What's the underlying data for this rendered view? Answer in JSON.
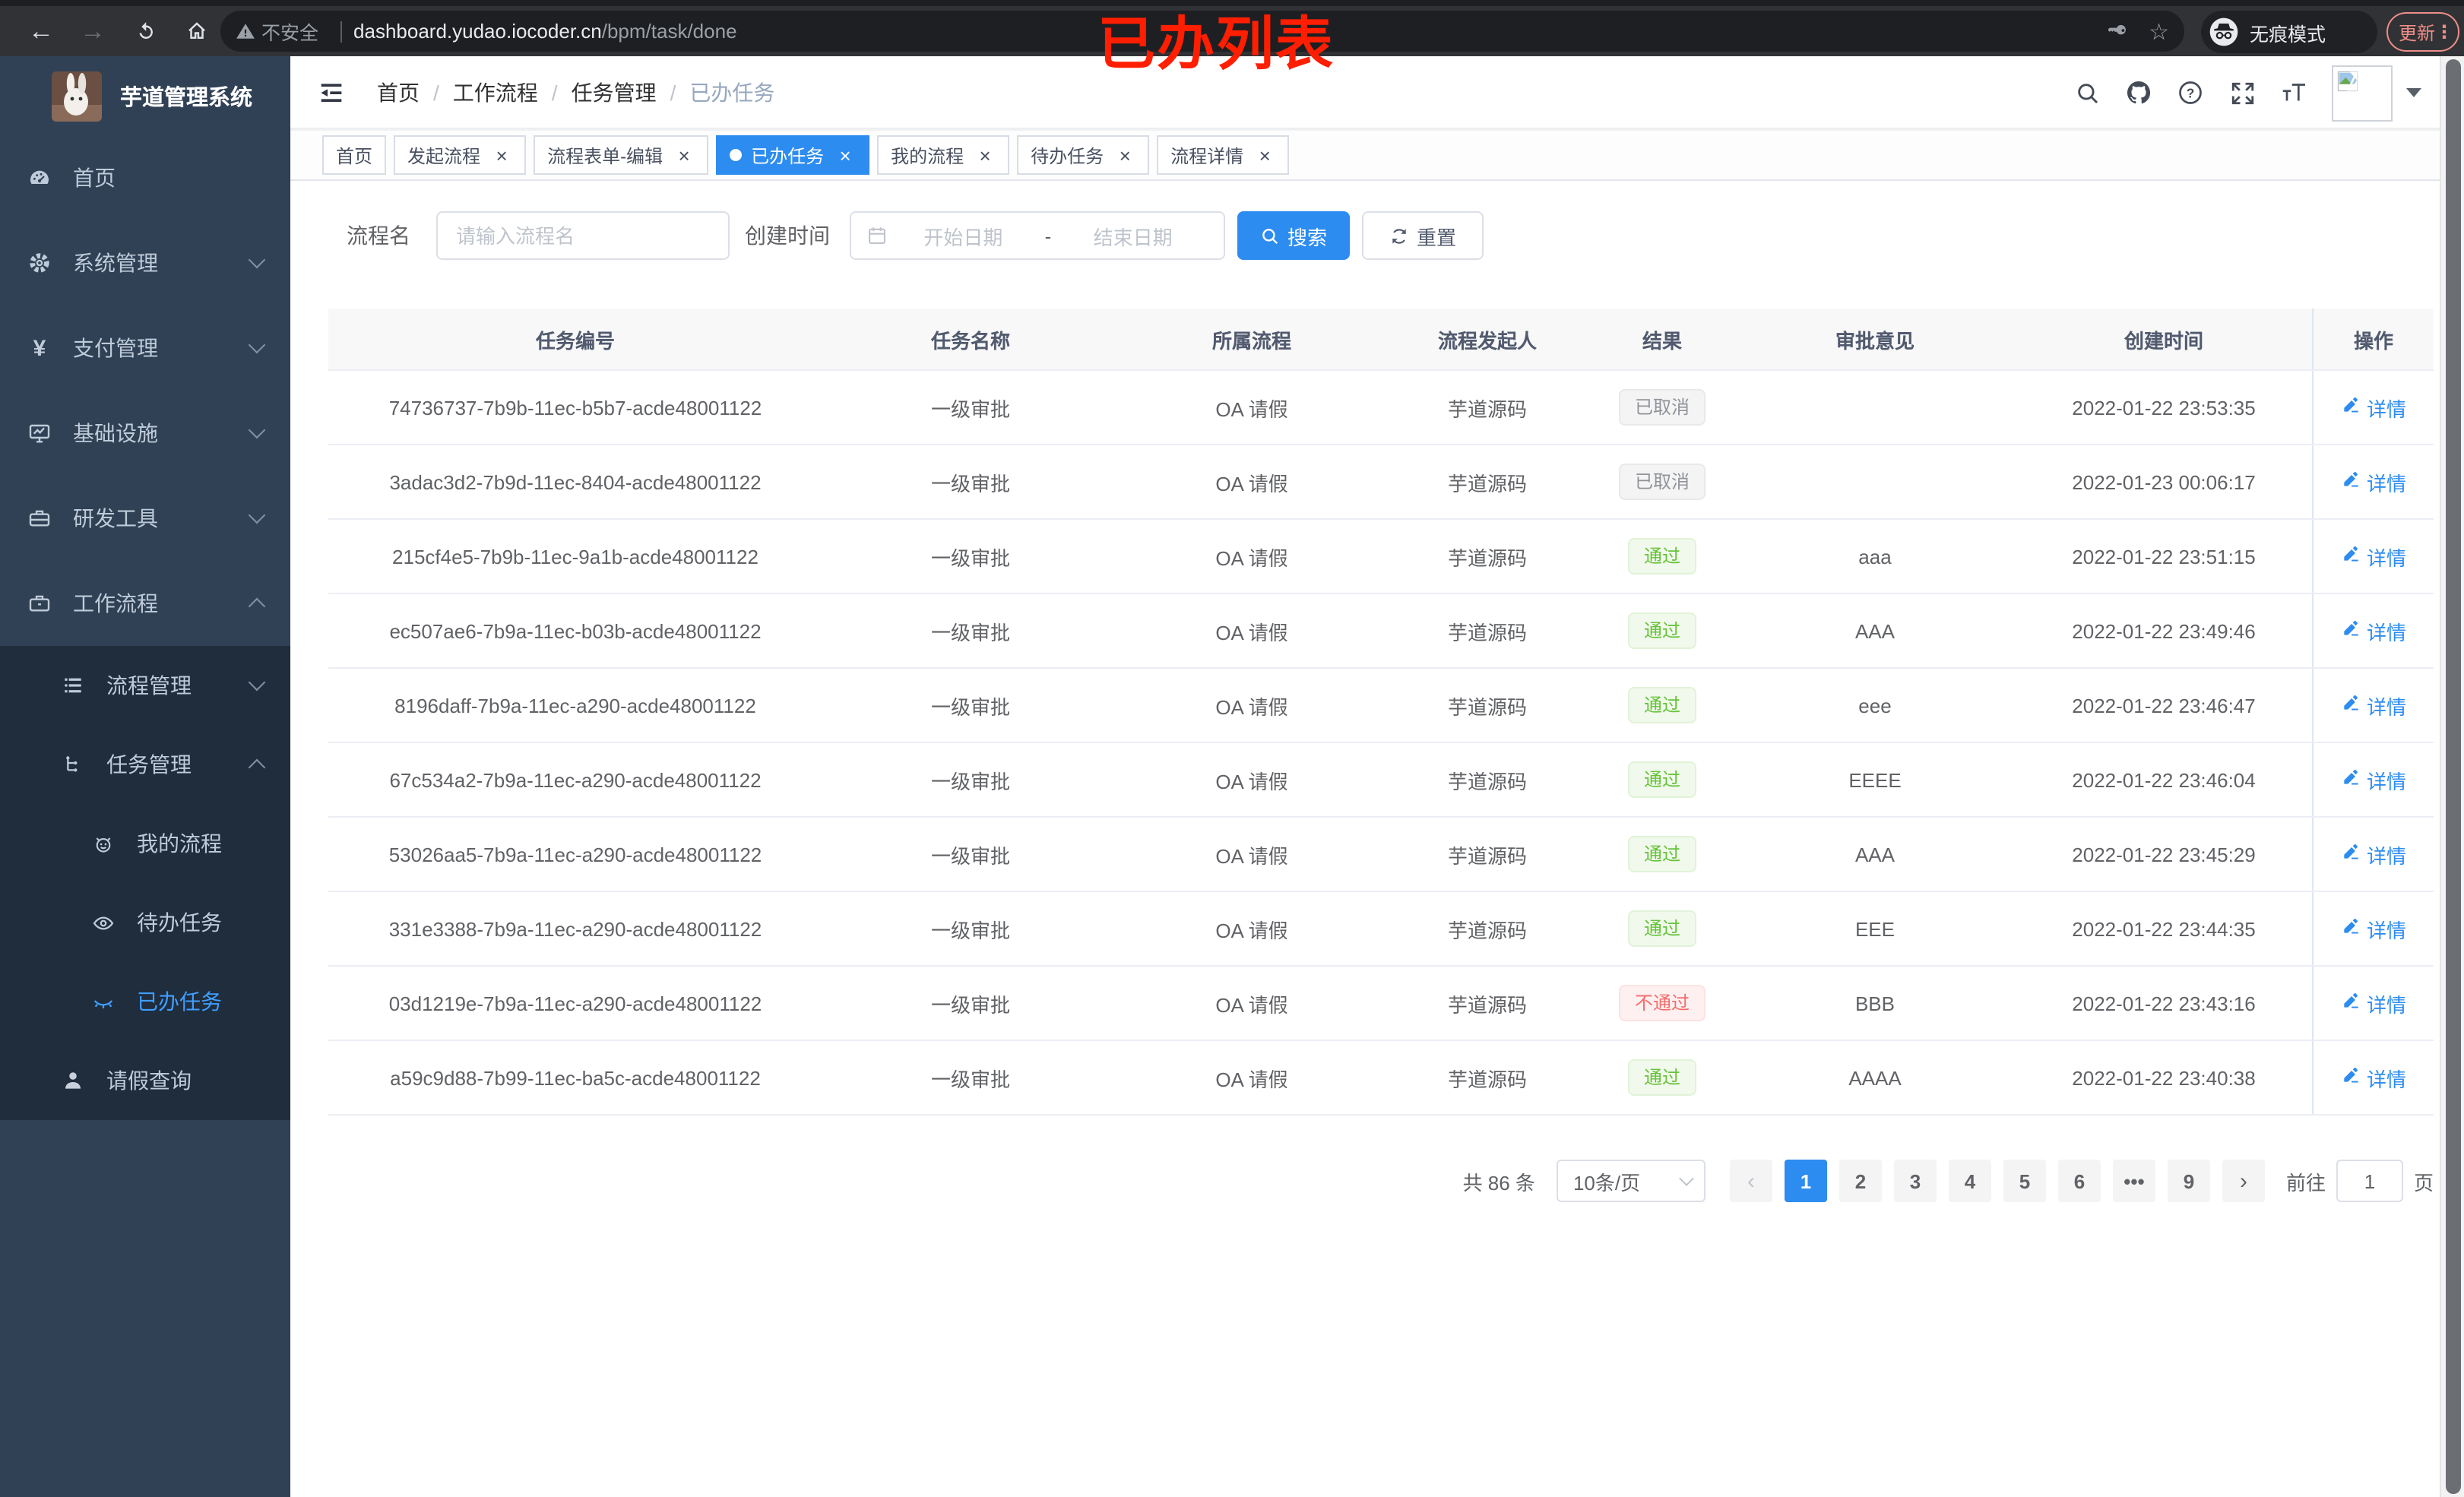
{
  "browser": {
    "annotation": "已办列表",
    "security_label": "不安全",
    "url_host": "dashboard.yudao.iocoder.cn",
    "url_path": "/bpm/task/done",
    "incognito_label": "无痕模式",
    "update_label": "更新"
  },
  "sidebar": {
    "app_title": "芋道管理系统",
    "items": [
      {
        "label": "首页",
        "icon": "dashboard-icon",
        "level": 1
      },
      {
        "label": "系统管理",
        "icon": "gear-icon",
        "level": 1,
        "chevron": "down"
      },
      {
        "label": "支付管理",
        "icon": "yen-icon",
        "level": 1,
        "chevron": "down"
      },
      {
        "label": "基础设施",
        "icon": "monitor-icon",
        "level": 1,
        "chevron": "down"
      },
      {
        "label": "研发工具",
        "icon": "toolbox-icon",
        "level": 1,
        "chevron": "down"
      },
      {
        "label": "工作流程",
        "icon": "briefcase-icon",
        "level": 1,
        "chevron": "up"
      }
    ],
    "submenu": [
      {
        "label": "流程管理",
        "icon": "list-icon",
        "level": 2,
        "chevron": "down"
      },
      {
        "label": "任务管理",
        "icon": "flow-icon",
        "level": 2,
        "chevron": "up"
      },
      {
        "label": "我的流程",
        "icon": "robot-icon",
        "level": 3
      },
      {
        "label": "待办任务",
        "icon": "eye-icon",
        "level": 3
      },
      {
        "label": "已办任务",
        "icon": "eye-closed-icon",
        "level": 3,
        "active": true
      },
      {
        "label": "请假查询",
        "icon": "user-icon",
        "level": 2
      }
    ]
  },
  "breadcrumb": {
    "separator": "/",
    "items": [
      "首页",
      "工作流程",
      "任务管理",
      "已办任务"
    ]
  },
  "tabs": [
    {
      "label": "首页",
      "closable": false,
      "active": false
    },
    {
      "label": "发起流程",
      "closable": true,
      "active": false
    },
    {
      "label": "流程表单-编辑",
      "closable": true,
      "active": false
    },
    {
      "label": "已办任务",
      "closable": true,
      "active": true
    },
    {
      "label": "我的流程",
      "closable": true,
      "active": false
    },
    {
      "label": "待办任务",
      "closable": true,
      "active": false
    },
    {
      "label": "流程详情",
      "closable": true,
      "active": false
    }
  ],
  "search": {
    "name_label": "流程名",
    "name_placeholder": "请输入流程名",
    "time_label": "创建时间",
    "start_placeholder": "开始日期",
    "range_separator": "-",
    "end_placeholder": "结束日期",
    "search_label": "搜索",
    "reset_label": "重置"
  },
  "table": {
    "columns": [
      "任务编号",
      "任务名称",
      "所属流程",
      "流程发起人",
      "结果",
      "审批意见",
      "创建时间",
      "操作"
    ],
    "detail_label": "详情",
    "rows": [
      {
        "id": "74736737-7b9b-11ec-b5b7-acde48001122",
        "name": "一级审批",
        "process": "OA 请假",
        "starter": "芋道源码",
        "result": "已取消",
        "result_type": "info",
        "comment": "",
        "time": "2022-01-22 23:53:35"
      },
      {
        "id": "3adac3d2-7b9d-11ec-8404-acde48001122",
        "name": "一级审批",
        "process": "OA 请假",
        "starter": "芋道源码",
        "result": "已取消",
        "result_type": "info",
        "comment": "",
        "time": "2022-01-23 00:06:17"
      },
      {
        "id": "215cf4e5-7b9b-11ec-9a1b-acde48001122",
        "name": "一级审批",
        "process": "OA 请假",
        "starter": "芋道源码",
        "result": "通过",
        "result_type": "success",
        "comment": "aaa",
        "time": "2022-01-22 23:51:15"
      },
      {
        "id": "ec507ae6-7b9a-11ec-b03b-acde48001122",
        "name": "一级审批",
        "process": "OA 请假",
        "starter": "芋道源码",
        "result": "通过",
        "result_type": "success",
        "comment": "AAA",
        "time": "2022-01-22 23:49:46"
      },
      {
        "id": "8196daff-7b9a-11ec-a290-acde48001122",
        "name": "一级审批",
        "process": "OA 请假",
        "starter": "芋道源码",
        "result": "通过",
        "result_type": "success",
        "comment": "eee",
        "time": "2022-01-22 23:46:47"
      },
      {
        "id": "67c534a2-7b9a-11ec-a290-acde48001122",
        "name": "一级审批",
        "process": "OA 请假",
        "starter": "芋道源码",
        "result": "通过",
        "result_type": "success",
        "comment": "EEEE",
        "time": "2022-01-22 23:46:04"
      },
      {
        "id": "53026aa5-7b9a-11ec-a290-acde48001122",
        "name": "一级审批",
        "process": "OA 请假",
        "starter": "芋道源码",
        "result": "通过",
        "result_type": "success",
        "comment": "AAA",
        "time": "2022-01-22 23:45:29"
      },
      {
        "id": "331e3388-7b9a-11ec-a290-acde48001122",
        "name": "一级审批",
        "process": "OA 请假",
        "starter": "芋道源码",
        "result": "通过",
        "result_type": "success",
        "comment": "EEE",
        "time": "2022-01-22 23:44:35"
      },
      {
        "id": "03d1219e-7b9a-11ec-a290-acde48001122",
        "name": "一级审批",
        "process": "OA 请假",
        "starter": "芋道源码",
        "result": "不通过",
        "result_type": "danger",
        "comment": "BBB",
        "time": "2022-01-22 23:43:16"
      },
      {
        "id": "a59c9d88-7b99-11ec-ba5c-acde48001122",
        "name": "一级审批",
        "process": "OA 请假",
        "starter": "芋道源码",
        "result": "通过",
        "result_type": "success",
        "comment": "AAAA",
        "time": "2022-01-22 23:40:38"
      }
    ]
  },
  "pagination": {
    "total_label": "共 86 条",
    "page_size_label": "10条/页",
    "prev_label": "‹",
    "next_label": "›",
    "pages": [
      "1",
      "2",
      "3",
      "4",
      "5",
      "6",
      "•••",
      "9"
    ],
    "active_page": "1",
    "goto_label": "前往",
    "goto_value": "1",
    "page_suffix": "页"
  },
  "colors": {
    "accent": "#2d8cf0",
    "sidebar_bg": "#304156",
    "submenu_bg": "#1f2d3d",
    "sidebar_text": "#bfcbd9",
    "active_menu": "#409eff",
    "success_text": "#67c23a",
    "danger_text": "#f56c6c",
    "info_text": "#909399",
    "annotation_red": "#ff1f00",
    "update_red": "#ee8d87"
  }
}
